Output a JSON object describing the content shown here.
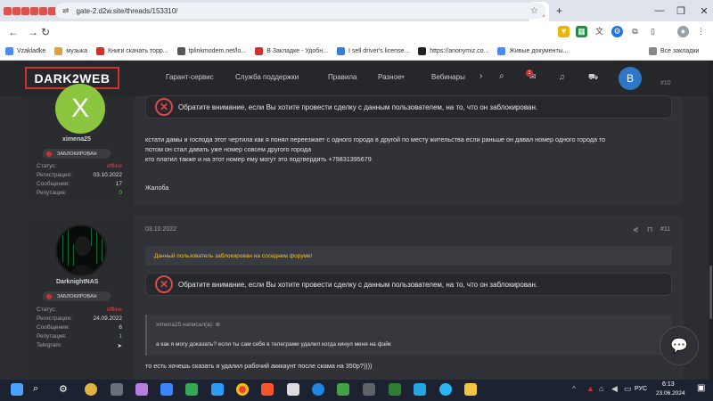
{
  "browser": {
    "tab_title_initial": "К",
    "url": "gate-2.d2w.site/threads/153310/",
    "window_controls": {
      "minimize": "—",
      "maximize": "❐",
      "close": "✕"
    },
    "new_tab": "+"
  },
  "bookmarks": [
    {
      "label": "Vzakladke",
      "color": "#4c8bf5"
    },
    {
      "label": "музыка",
      "color": "#e3a13b"
    },
    {
      "label": "Книги скачать торр...",
      "color": "#d0312d"
    },
    {
      "label": "tplinkmodem.net/lo...",
      "color": "#555555"
    },
    {
      "label": "В Закладке - Удобн...",
      "color": "#d0312d"
    },
    {
      "label": "I sell driver's license...",
      "color": "#3a7bd5"
    },
    {
      "label": "https://anonymiz.co...",
      "color": "#222222"
    },
    {
      "label": "Живые документы...",
      "color": "#4c8bf5"
    }
  ],
  "bookmarks_all": "Все закладки",
  "site": {
    "logo": "DARK2WEB",
    "nav": [
      "Гарант-сервис",
      "Служба поддержки",
      "Правила",
      "Разное",
      "Вебинары"
    ],
    "avatar_letter": "B",
    "notif_count": "1"
  },
  "post1": {
    "username": "ximena25",
    "avatar_letter": "X",
    "status_badge": "ЗАБЛОКИРОВАН",
    "info": [
      {
        "k": "Статус:",
        "v": "offline"
      },
      {
        "k": "Регистрация:",
        "v": "03.10.2022"
      },
      {
        "k": "Сообщения:",
        "v": "17"
      },
      {
        "k": "Репутация:",
        "v": "0"
      }
    ],
    "post_number": "#10",
    "warning": "Обратите внимание, если Вы хотите провести сделку с данным пользователем, на то, что он заблокирован.",
    "text_lines": [
      "кстати дамы и господа этот чертила как я понял переезжает с одного города в другой по месту жительства если раньше он давал номер одного города то",
      "потом он стал давать уже номер совсем другого города",
      "кто платил также и на этот номер ему могут это подтвердить +79831395679"
    ],
    "report": "Жалоба"
  },
  "post2": {
    "date": "03.10.2022",
    "post_number": "#11",
    "username": "DarknightNAS",
    "status_badge": "ЗАБЛОКИРОВАН",
    "info": [
      {
        "k": "Статус:",
        "v": "offline"
      },
      {
        "k": "Регистрация:",
        "v": "24.09.2022"
      },
      {
        "k": "Сообщения:",
        "v": "6"
      },
      {
        "k": "Репутация:",
        "v": "1"
      },
      {
        "k": "Telegram:",
        "v": ""
      }
    ],
    "notice": "Данный пользователь заблокирован на соседнем форуме!",
    "warning": "Обратите внимание, если Вы хотите провести сделку с данным пользователем, на то, что он заблокирован.",
    "quote_author": "ximena25 написал(а):",
    "quote_text": "а как я могу доказать? если ты сам себя в телеграме удалил когда кинул меня на фэйк",
    "reply": "то есть хочешь сказать я удалил рабочий акккаунт после скама на 350р?))))"
  },
  "taskbar": {
    "lang": "РУС",
    "time": "6:13",
    "date": "23.06.2024"
  },
  "colors": {
    "accent": "#d0312d",
    "bg": "#2b2d31",
    "offline": "#d84a4a",
    "notice": "#e8c23a"
  }
}
